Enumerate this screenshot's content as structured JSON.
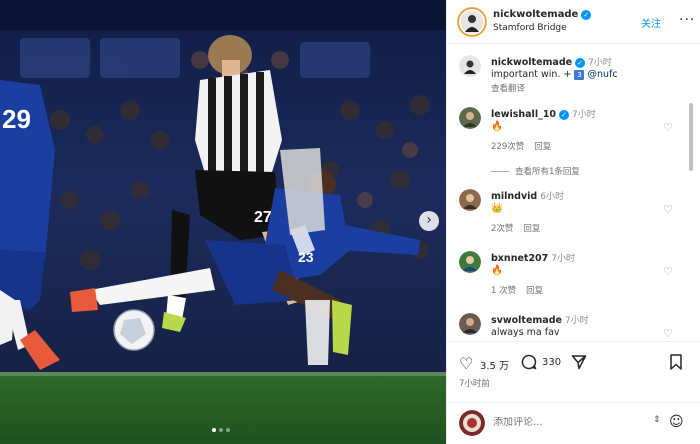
{
  "header": {
    "username": "nickwoltemade",
    "location": "Stamford Bridge",
    "follow_label": "关注",
    "more_icon": "more-horizontal-icon"
  },
  "caption": {
    "username": "nickwoltemade",
    "time": "7小时",
    "text": "important win. +",
    "tag_number": "3",
    "mention": "@nufc",
    "translate_label": "查看翻译"
  },
  "comments": [
    {
      "username": "lewishall_10",
      "verified": true,
      "time": "7小时",
      "text": "🔥",
      "likes": "229次赞",
      "reply_label": "回复",
      "view_replies": "查看所有1条回复"
    },
    {
      "username": "milndvid",
      "verified": false,
      "time": "6小时",
      "text": "👑",
      "likes": "2次赞",
      "reply_label": "回复"
    },
    {
      "username": "bxnnet207",
      "verified": false,
      "time": "7小时",
      "text": "🔥",
      "likes": "1 次赞",
      "reply_label": "回复"
    },
    {
      "username": "svwoltemade",
      "verified": false,
      "time": "7小时",
      "text": "always ma fav"
    }
  ],
  "actions": {
    "like_count": "3.5 万",
    "comment_count": "330",
    "post_time": "7小时前"
  },
  "composer": {
    "placeholder": "添加评论..."
  },
  "media": {
    "slide_count": 3,
    "active_slide": 1,
    "player_numbers": [
      "29",
      "27",
      "23"
    ],
    "next_icon": "chevron-right-icon"
  },
  "colors": {
    "accent_blue": "#0095f6",
    "chelsea_blue": "#1a3fa0",
    "pitch_green": "#2f6b2a"
  }
}
